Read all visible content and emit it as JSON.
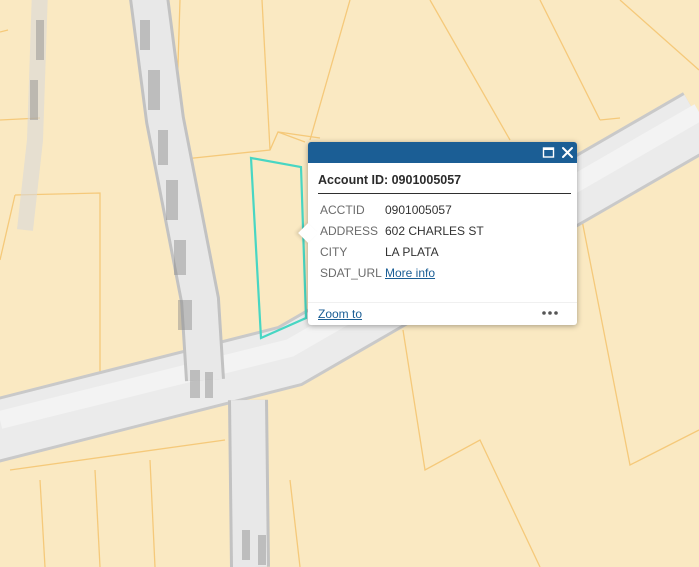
{
  "map": {
    "colors": {
      "parcel_fill": "#fae9c2",
      "parcel_line": "#f5c97a",
      "road": "#e9e9e9",
      "road_edge": "#c9c9c9",
      "selection": "#48d6c3"
    }
  },
  "popup": {
    "header_color": "#1b5e95",
    "icons": {
      "maximize": "maximize-icon",
      "close": "close-icon",
      "more": "more-options-icon"
    },
    "title": "Account ID: 0901005057",
    "fields": [
      {
        "key": "ACCTID",
        "value": "0901005057"
      },
      {
        "key": "ADDRESS",
        "value": "602 CHARLES ST"
      },
      {
        "key": "CITY",
        "value": "LA PLATA"
      },
      {
        "key": "SDAT_URL",
        "value": "More info"
      }
    ],
    "zoom_label": "Zoom to"
  }
}
